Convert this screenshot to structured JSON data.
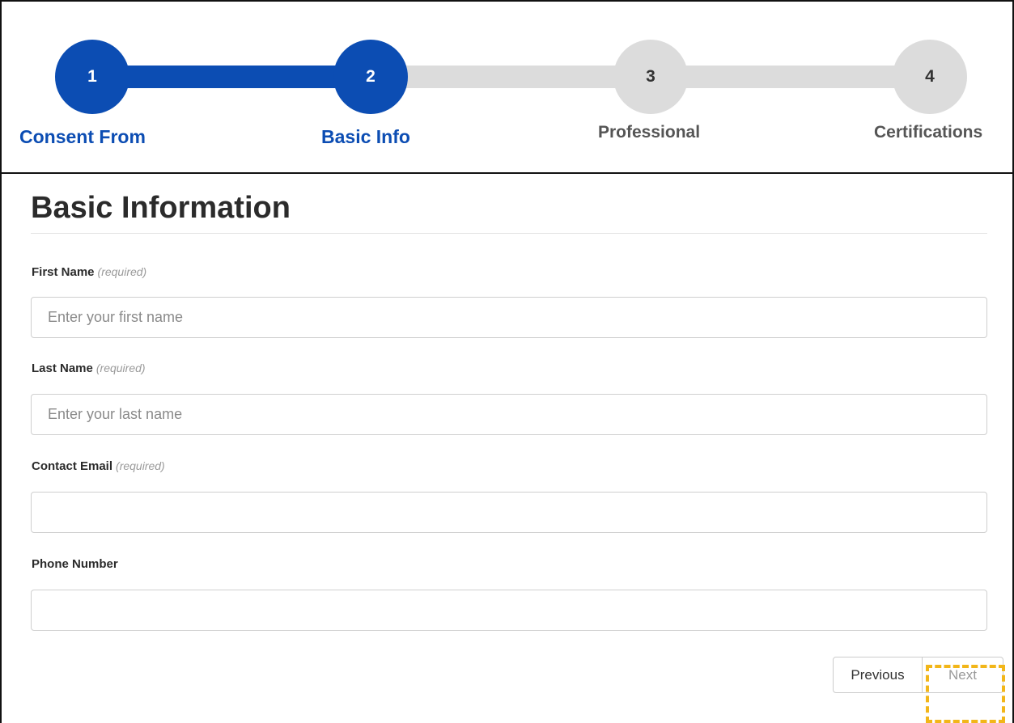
{
  "stepper": {
    "steps": [
      {
        "number": "1",
        "label": "Consent From"
      },
      {
        "number": "2",
        "label": "Basic Info"
      },
      {
        "number": "3",
        "label": "Professional"
      },
      {
        "number": "4",
        "label": "Certifications"
      }
    ],
    "current_step": 2,
    "colors": {
      "active": "#0c4db3",
      "inactive": "#dcdcdc"
    }
  },
  "form": {
    "title": "Basic Information",
    "fields": [
      {
        "label": "First Name",
        "required_note": "(required)",
        "placeholder": "Enter your first name",
        "value": ""
      },
      {
        "label": "Last Name",
        "required_note": "(required)",
        "placeholder": "Enter your last name",
        "value": ""
      },
      {
        "label": "Contact Email",
        "required_note": "(required)",
        "placeholder": "",
        "value": ""
      },
      {
        "label": "Phone Number",
        "required_note": "",
        "placeholder": "",
        "value": ""
      }
    ]
  },
  "buttons": {
    "previous_label": "Previous",
    "next_label": "Next"
  },
  "highlight_color": "#f2b619"
}
